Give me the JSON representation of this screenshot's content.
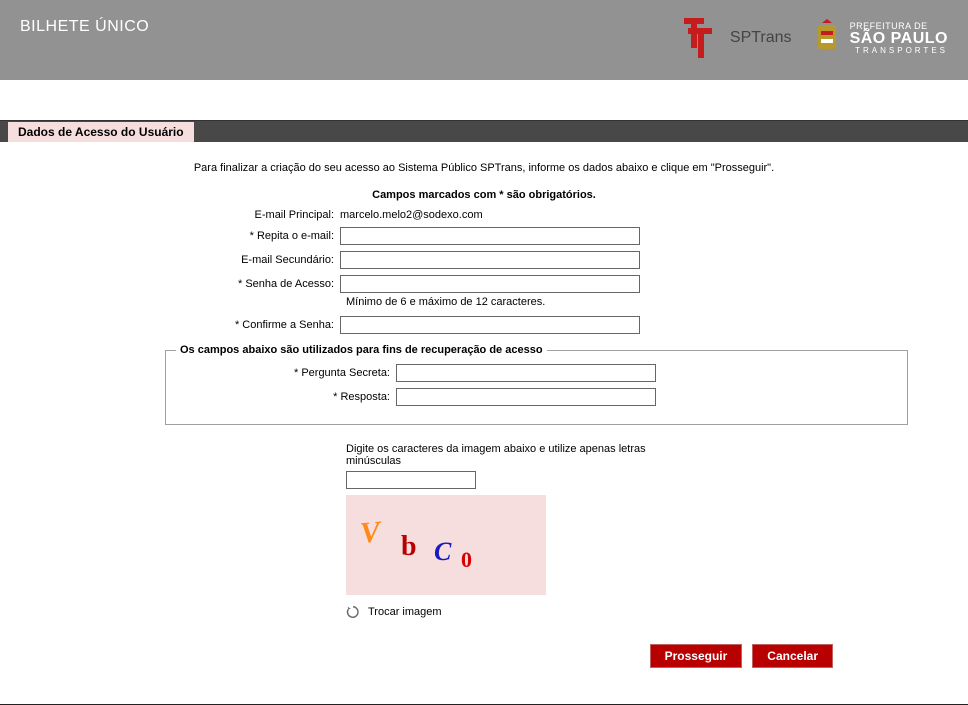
{
  "header": {
    "title": "BILHETE ÚNICO",
    "sptrans_text": "SPTrans",
    "prefeitura_line1": "PREFEITURA DE",
    "prefeitura_line2": "SÃO PAULO",
    "prefeitura_line3": "TRANSPORTES"
  },
  "section_label": "Dados de Acesso do Usuário",
  "intro": "Para finalizar a criação do seu acesso ao Sistema Público SPTrans, informe os dados abaixo e clique em \"Prosseguir\".",
  "required_note": "Campos marcados com * são obrigatórios.",
  "form": {
    "email_principal_label": "E-mail Principal:",
    "email_principal_value": "marcelo.melo2@sodexo.com",
    "repita_email_label": "* Repita o e-mail:",
    "email_secundario_label": "E-mail Secundário:",
    "senha_label": "* Senha de Acesso:",
    "senha_hint": "Mínimo de 6 e máximo de 12 caracteres.",
    "confirme_senha_label": "* Confirme a Senha:"
  },
  "recovery": {
    "legend": "Os campos abaixo são utilizados para fins de recuperação de acesso",
    "pergunta_label": "* Pergunta Secreta:",
    "resposta_label": "* Resposta:"
  },
  "captcha": {
    "instruction": "Digite os caracteres da imagem abaixo e utilize apenas letras minúsculas",
    "chars": [
      "V",
      "b",
      "C",
      "0"
    ],
    "refresh_label": "Trocar imagem"
  },
  "buttons": {
    "prosseguir": "Prosseguir",
    "cancelar": "Cancelar"
  }
}
